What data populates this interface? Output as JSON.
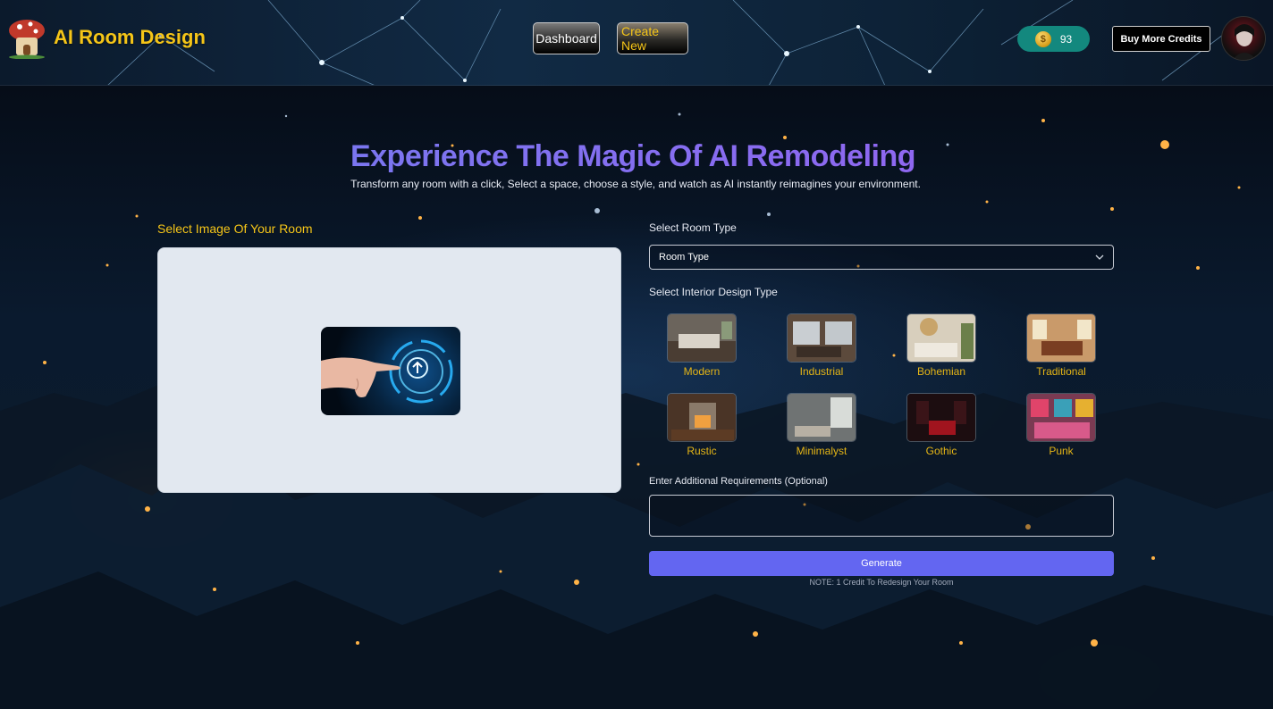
{
  "header": {
    "brand_title": "AI Room Design",
    "nav": {
      "dashboard_label": "Dashboard",
      "create_new_label": "Create New"
    },
    "credits": {
      "count": "93",
      "icon": "coin-icon",
      "color": "#13887e"
    },
    "buy_credits_label": "Buy More Credits"
  },
  "hero": {
    "title": "Experience The Magic Of AI Remodeling",
    "subtitle": "Transform any room with a click, Select a space, choose a style, and watch as AI instantly reimagines your environment."
  },
  "upload": {
    "label": "Select Image Of Your Room",
    "icon": "upload-hand-icon"
  },
  "form": {
    "room_type_label": "Select Room Type",
    "room_type_value": "Room Type",
    "design_type_label": "Select Interior Design Type",
    "design_styles": [
      {
        "name": "Modern"
      },
      {
        "name": "Industrial"
      },
      {
        "name": "Bohemian"
      },
      {
        "name": "Traditional"
      },
      {
        "name": "Rustic"
      },
      {
        "name": "Minimalyst"
      },
      {
        "name": "Gothic"
      },
      {
        "name": "Punk"
      }
    ],
    "requirements_label": "Enter Additional Requirements (Optional)",
    "requirements_value": "",
    "generate_label": "Generate",
    "note": "NOTE: 1 Credit To Redesign Your Room"
  },
  "colors": {
    "accent": "#6366f1",
    "brand_gold": "#f5c518",
    "title_gradient_start": "#6f7ff0",
    "title_gradient_end": "#9a5ef0"
  }
}
